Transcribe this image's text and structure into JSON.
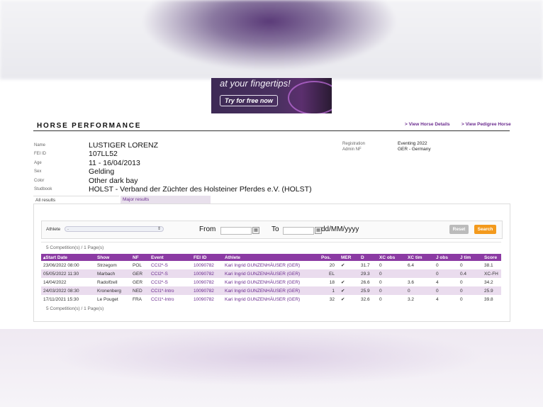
{
  "ad": {
    "tagline": "at your fingertips!",
    "cta": "Try for free now"
  },
  "page": {
    "title": "HORSE PERFORMANCE",
    "links": {
      "horse_details": "> View Horse Details",
      "pedigree": "> View Pedigree Horse"
    }
  },
  "horse": {
    "fields": [
      {
        "label": "Name",
        "value": "LUSTIGER LORENZ"
      },
      {
        "label": "FEI ID",
        "value": "107LL52"
      },
      {
        "label": "Age",
        "value": "11 - 16/04/2013"
      },
      {
        "label": "Sex",
        "value": "Gelding"
      },
      {
        "label": "Color",
        "value": "Other dark bay"
      },
      {
        "label": "Studbook",
        "value": "HOLST - Verband der Züchter des Holsteiner Pferdes e.V. (HOLST)"
      }
    ],
    "right_fields": [
      {
        "label": "Registration",
        "value": "Eventing 2022"
      },
      {
        "label": "Admin NF",
        "value": "GER - Germany"
      }
    ]
  },
  "tabs": {
    "all": "All results",
    "major": "Major results"
  },
  "filter": {
    "athlete_label": "Athlete",
    "athlete_value": "-",
    "from_label": "From",
    "to_label": "To",
    "date_format": "dd/MM/yyyy",
    "reset": "Reset",
    "search": "Search"
  },
  "summary": "5 Competition(s) / 1 Page(s)",
  "table": {
    "headers": [
      "Start Date",
      "Show",
      "NF",
      "Event",
      "FEI ID",
      "Athlete",
      "Pos.",
      "MER",
      "D",
      "XC obs",
      "XC tim",
      "J obs",
      "J tim",
      "Score"
    ],
    "sort_marker": "▴",
    "rows": [
      [
        "23/06/2022 08:00",
        "Strzegom",
        "POL",
        "CCI2*-S",
        "10090782",
        "Kari Ingrid GUNZENHÄUSER (GER)",
        "20",
        "✔",
        "31.7",
        "0",
        "6.4",
        "0",
        "0",
        "38.1"
      ],
      [
        "05/05/2022 11:30",
        "Marbach",
        "GER",
        "CCI2*-S",
        "10090782",
        "Kari Ingrid GUNZENHÄUSER (GER)",
        "EL",
        "",
        "29.3",
        "0",
        "",
        "0",
        "0.4",
        "XC-FH"
      ],
      [
        "14/04/2022",
        "Radolfzell",
        "GER",
        "CCI2*-S",
        "10090782",
        "Kari Ingrid GUNZENHÄUSER (GER)",
        "18",
        "✔",
        "26.6",
        "0",
        "3.6",
        "4",
        "0",
        "34.2"
      ],
      [
        "24/03/2022 08:30",
        "Kronenberg",
        "NED",
        "CCI1*-Intro",
        "10090782",
        "Kari Ingrid GUNZENHÄUSER (GER)",
        "1",
        "✔",
        "25.9",
        "0",
        "0",
        "0",
        "0",
        "25.9"
      ],
      [
        "17/11/2021 15:30",
        "Le Pouget",
        "FRA",
        "CCI1*-Intro",
        "10090782",
        "Kari Ingrid GUNZENHÄUSER (GER)",
        "32",
        "✔",
        "32.6",
        "0",
        "3.2",
        "4",
        "0",
        "39.8"
      ]
    ]
  }
}
